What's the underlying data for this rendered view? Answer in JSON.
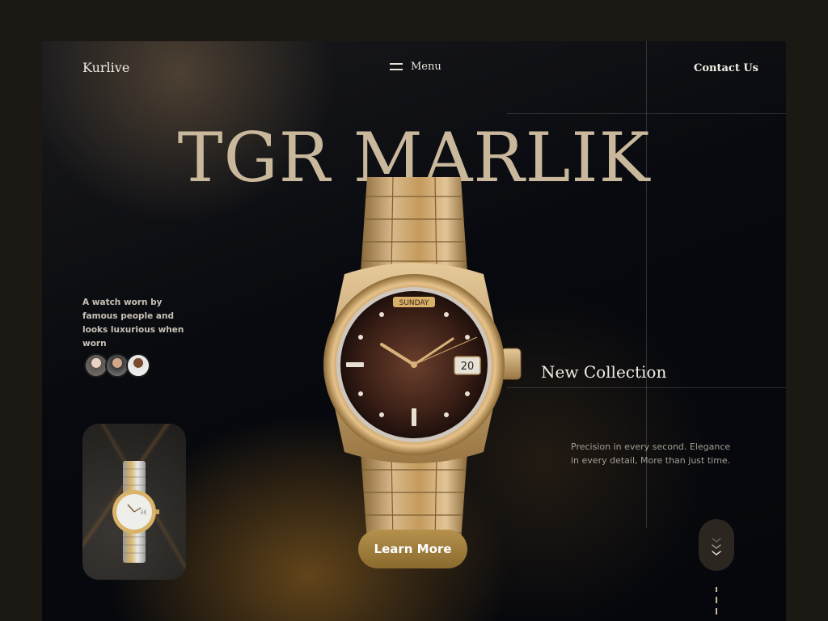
{
  "header": {
    "logo": "Kurlive",
    "menu_label": "Menu",
    "contact_label": "Contact Us"
  },
  "hero": {
    "title": "TGR MARLIK",
    "tagline": "A watch worn by famous people and looks luxurious when worn",
    "new_collection": "New Collection",
    "description": "Precision in every second. Elegance in every detail, More than just time.",
    "cta_label": "Learn More"
  },
  "watch_dial": {
    "day": "SUNDAY",
    "date": "20"
  },
  "thumbnail_dial": {
    "date": "20"
  },
  "colors": {
    "accent_gold": "#b5914c",
    "headline": "#c9b89c",
    "background": "#05070c"
  },
  "icons": [
    "hamburger-menu-icon",
    "chevron-down-icon"
  ]
}
